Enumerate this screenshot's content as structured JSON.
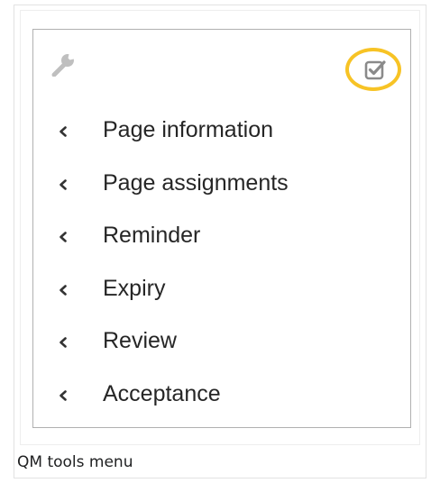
{
  "menu": {
    "items": [
      {
        "label": "Page information",
        "icon": "chevron-left-icon"
      },
      {
        "label": "Page assignments",
        "icon": "chevron-left-icon"
      },
      {
        "label": "Reminder",
        "icon": "chevron-left-icon"
      },
      {
        "label": "Expiry",
        "icon": "chevron-left-icon"
      },
      {
        "label": "Review",
        "icon": "chevron-left-icon"
      },
      {
        "label": "Acceptance",
        "icon": "chevron-left-icon"
      }
    ]
  },
  "icons": {
    "tools": "wrench-icon",
    "qm": "checkbox-checked-icon"
  },
  "colors": {
    "highlight": "#f7c325",
    "icon_gray": "#bfbfbf",
    "check_gray": "#8a8a8a",
    "panel_border": "#b0b0b0",
    "text": "#262626"
  },
  "caption": "QM tools menu"
}
